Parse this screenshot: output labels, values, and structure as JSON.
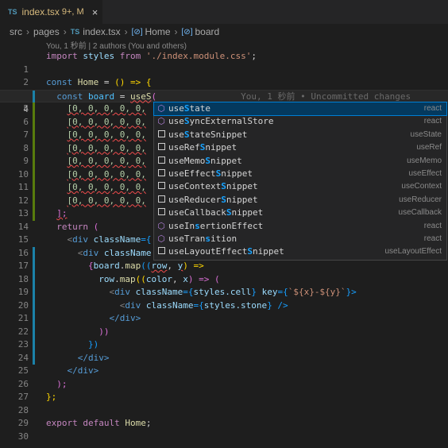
{
  "tab": {
    "lang": "TS",
    "filename": "index.tsx",
    "status": "9+, M",
    "close": "×"
  },
  "breadcrumb": {
    "items": [
      "src",
      "pages",
      "index.tsx",
      "Home",
      "board"
    ],
    "sep": "›",
    "ts": "TS",
    "sym": "[⊘]"
  },
  "codelens": "You, 1 秒前 | 2 authors (You and others)",
  "ghost_text": "You, 1 秒前 • Uncommitted changes",
  "lines": [
    {
      "n": "1"
    },
    {
      "n": "2"
    },
    {
      "n": "3"
    },
    {
      "n": "4"
    },
    {
      "n": "5"
    },
    {
      "n": "6"
    },
    {
      "n": "7"
    },
    {
      "n": "8"
    },
    {
      "n": "9"
    },
    {
      "n": "10"
    },
    {
      "n": "11"
    },
    {
      "n": "12"
    },
    {
      "n": "13"
    },
    {
      "n": "14"
    },
    {
      "n": "15"
    },
    {
      "n": "16"
    },
    {
      "n": "17"
    },
    {
      "n": "18"
    },
    {
      "n": "19"
    },
    {
      "n": "20"
    },
    {
      "n": "21"
    },
    {
      "n": "22"
    },
    {
      "n": "23"
    },
    {
      "n": "24"
    },
    {
      "n": "25"
    },
    {
      "n": "26"
    },
    {
      "n": "27"
    },
    {
      "n": "28"
    },
    {
      "n": "29"
    },
    {
      "n": "30"
    }
  ],
  "code": {
    "l1": {
      "import": "import",
      "styles": "styles",
      "from": "from",
      "path": "'./index.module.css'",
      "semi": ";"
    },
    "l3": {
      "const": "const",
      "name": "Home",
      "eq": " = ",
      "arrow": "() => {"
    },
    "l4": {
      "const": "const",
      "name": "board",
      "eq": " = ",
      "call": "useS",
      "paren": "("
    },
    "row": "[0, 0, 0, 0, 0,",
    "l13": "];",
    "l14": {
      "ret": "return",
      "paren": "("
    },
    "l15": {
      "open": "<",
      "tag": "div",
      "attr": "className",
      "eq": "={",
      "val": "styles.board",
      "close": "}>"
    },
    "l16": {
      "open": "<",
      "tag": "div",
      "attr": "className",
      "eq": "={",
      "val": "styles.row",
      "close": "}>"
    },
    "l17": {
      "text1": "{",
      "obj": "board",
      "text2": ".",
      "fn": "map",
      "text3": "((",
      "p1": "row",
      "comma": ", ",
      "p2": "y",
      "text4": ") =>"
    },
    "l18": {
      "obj": "row",
      "text2": ".",
      "fn": "map",
      "text3": "((",
      "p1": "color",
      "comma": ", ",
      "p2": "x",
      "text4": ") => ("
    },
    "l19": {
      "open": "<",
      "tag": "div",
      "attr": "className",
      "eq": "={",
      "val": "styles.cell",
      "mid": "} ",
      "attr2": "key",
      "eq2": "={",
      "tpl": "`${x}-${y}`",
      "close": "}>"
    },
    "l20": {
      "open": "<",
      "tag": "div",
      "attr": "className",
      "eq": "={",
      "val": "styles.stone",
      "close": "} />"
    },
    "l21": {
      "close": "</div>"
    },
    "l22": "))",
    "l23": "})",
    "l24": "</div>",
    "l25": "</div>",
    "l26": ");",
    "l27": "};",
    "l29": {
      "export": "export",
      "default": "default",
      "name": "Home",
      "semi": ";"
    }
  },
  "suggestions": [
    {
      "pre": "use",
      "match": "S",
      "post": "tate",
      "detail": "react",
      "icon": "function"
    },
    {
      "pre": "use",
      "match": "S",
      "post": "yncExternalStore",
      "detail": "react",
      "icon": "function"
    },
    {
      "pre": "use",
      "match": "S",
      "post": "tateSnippet",
      "detail": "useState",
      "icon": "snippet"
    },
    {
      "pre": "useRef",
      "match": "S",
      "post": "nippet",
      "detail": "useRef",
      "icon": "snippet"
    },
    {
      "pre": "useMemo",
      "match": "S",
      "post": "nippet",
      "detail": "useMemo",
      "icon": "snippet"
    },
    {
      "pre": "useEffect",
      "match": "S",
      "post": "nippet",
      "detail": "useEffect",
      "icon": "snippet"
    },
    {
      "pre": "useContext",
      "match": "S",
      "post": "nippet",
      "detail": "useContext",
      "icon": "snippet"
    },
    {
      "pre": "useReducer",
      "match": "S",
      "post": "nippet",
      "detail": "useReducer",
      "icon": "snippet"
    },
    {
      "pre": "useCallback",
      "match": "S",
      "post": "nippet",
      "detail": "useCallback",
      "icon": "snippet"
    },
    {
      "pre": "useIn",
      "match": "s",
      "post": "ertionEffect",
      "detail": "react",
      "icon": "function"
    },
    {
      "pre": "useTran",
      "match": "s",
      "post": "ition",
      "detail": "react",
      "icon": "function"
    },
    {
      "pre": "useLayoutEffect",
      "match": "S",
      "post": "nippet",
      "detail": "useLayoutEffect",
      "icon": "snippet"
    }
  ],
  "colors": {
    "accent": "#007fd4",
    "added": "#587c0c",
    "modified": "#1b81a8",
    "match": "#18a3ff"
  }
}
